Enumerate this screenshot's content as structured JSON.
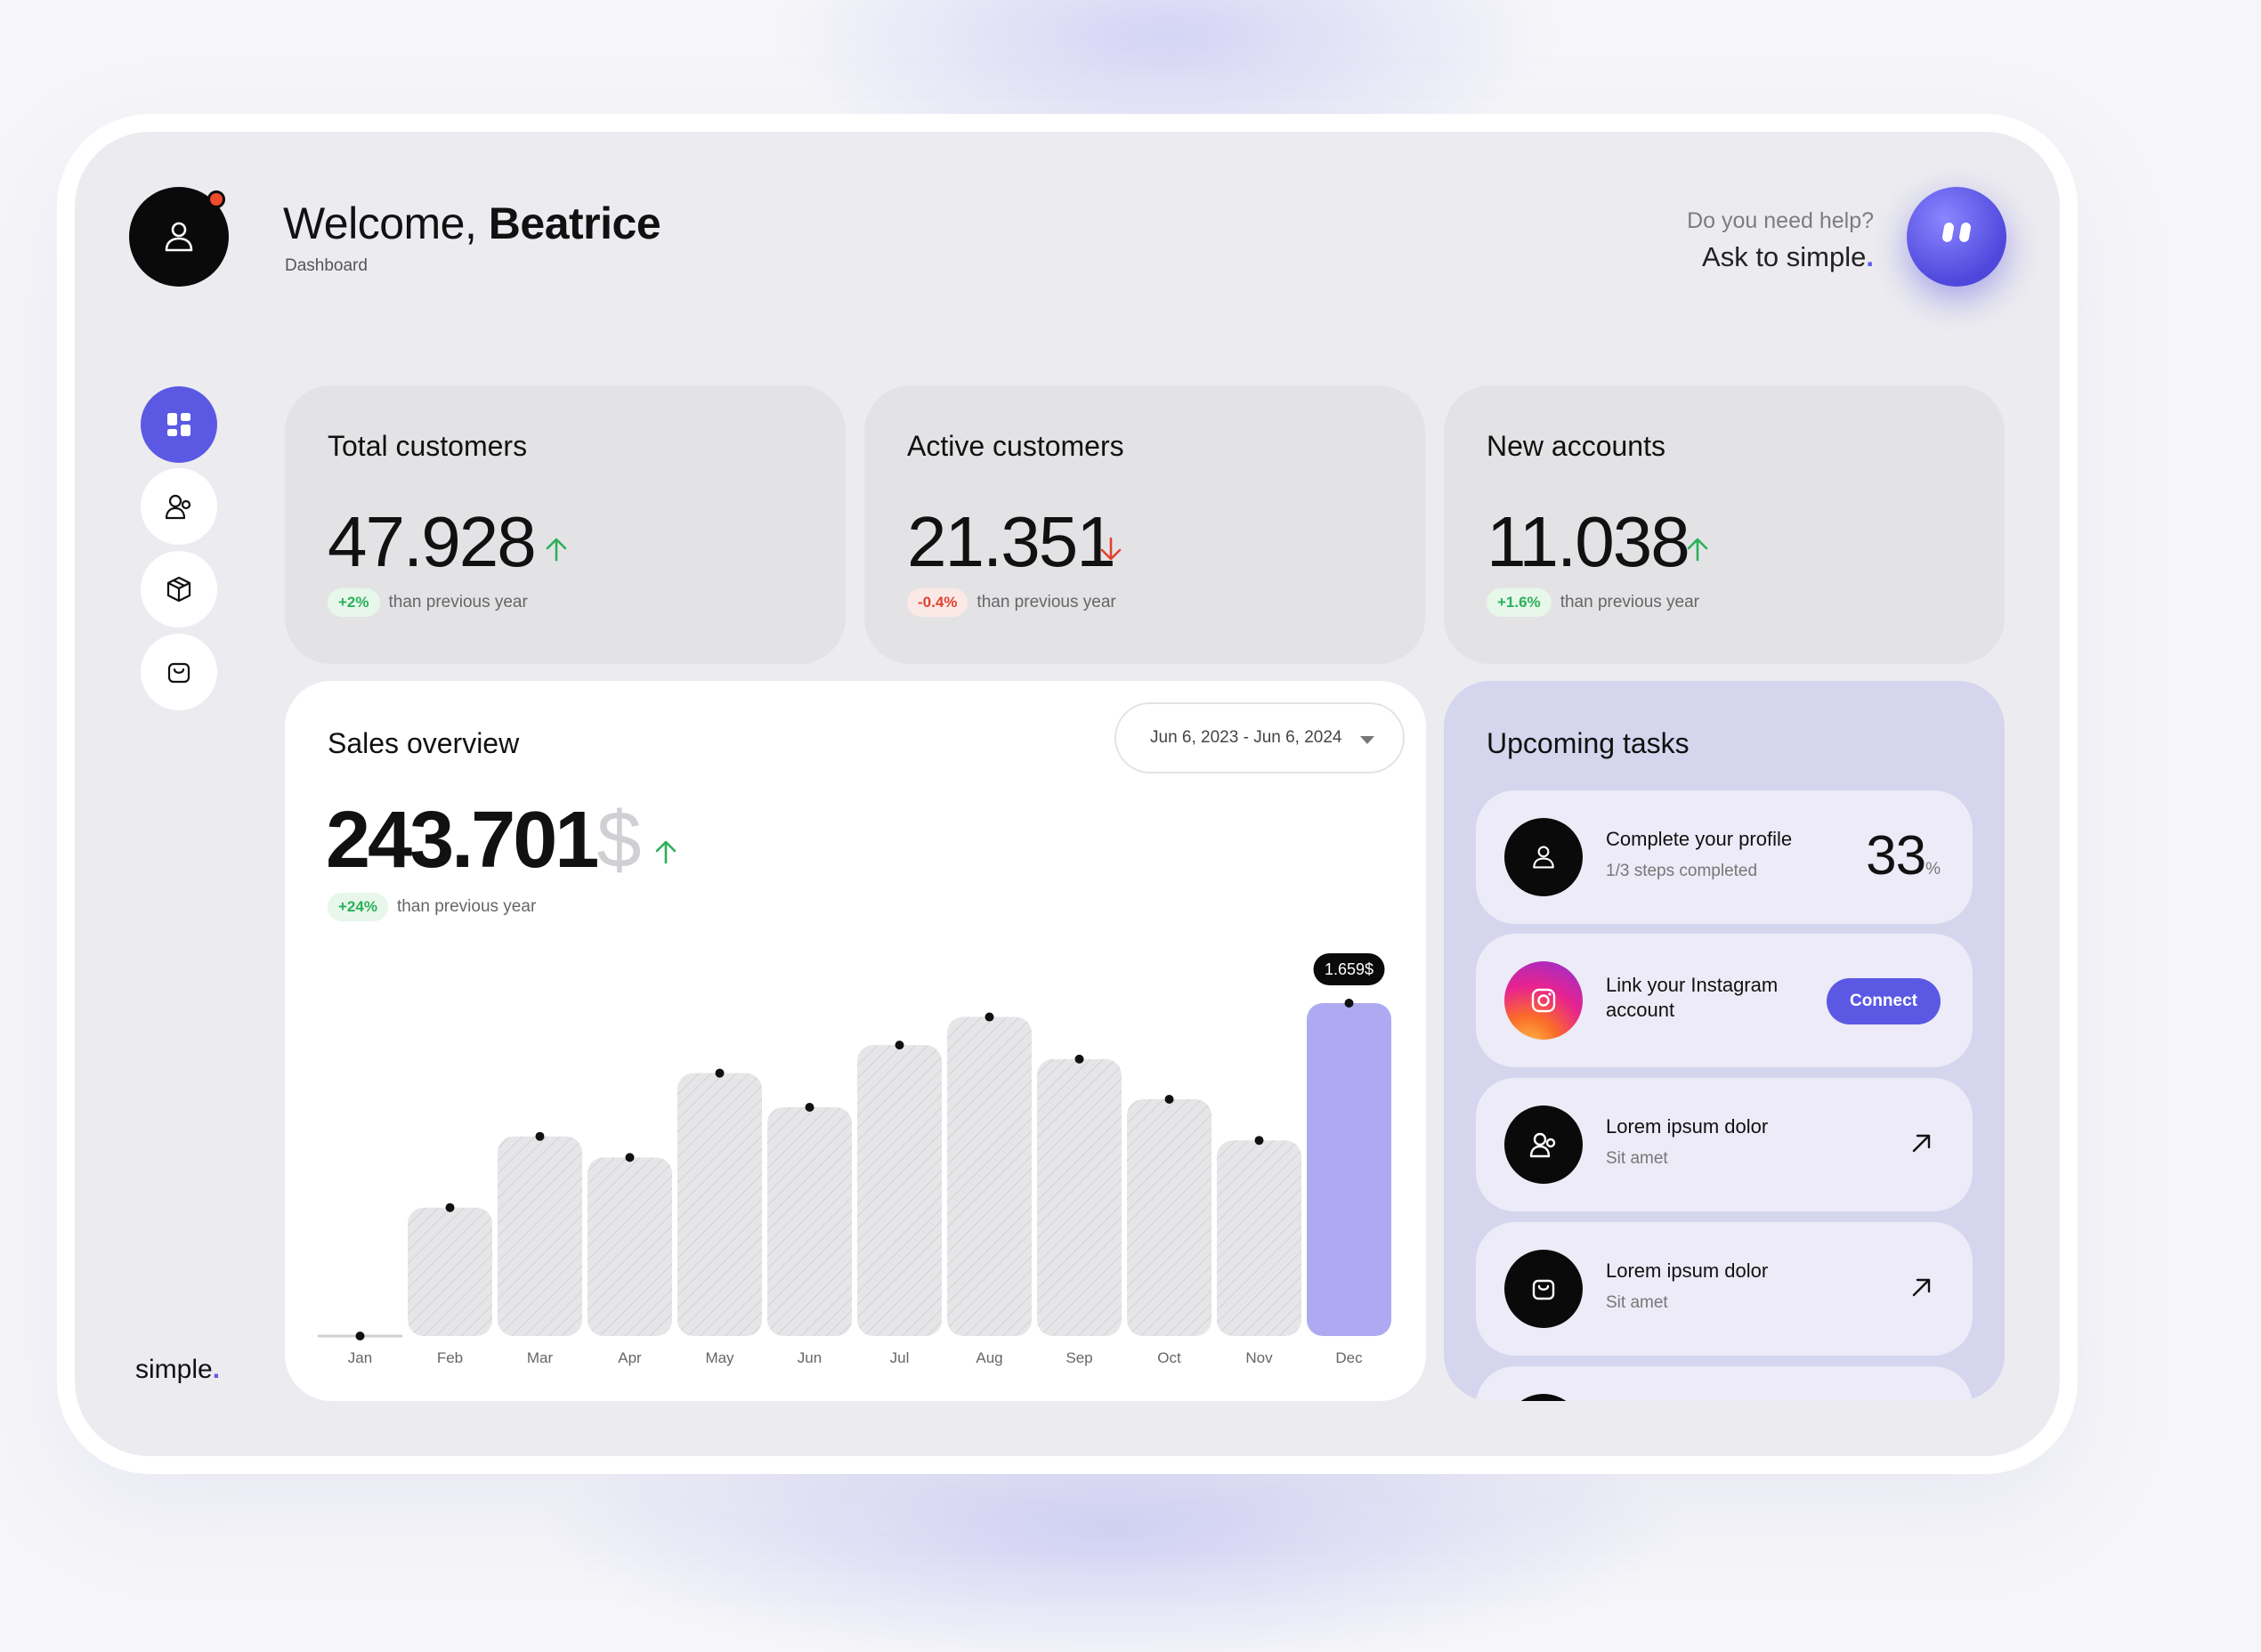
{
  "header": {
    "greeting": "Welcome,",
    "user_name": "Beatrice",
    "subtitle": "Dashboard",
    "help_question": "Do you need help?",
    "help_action": "Ask to simple",
    "help_dot": "."
  },
  "sidebar": {
    "items": [
      {
        "icon": "dashboard-icon",
        "active": true
      },
      {
        "icon": "users-icon",
        "active": false
      },
      {
        "icon": "box-icon",
        "active": false
      },
      {
        "icon": "bag-icon",
        "active": false
      }
    ],
    "brand": "simple",
    "brand_dot": "."
  },
  "stats": [
    {
      "title": "Total customers",
      "value": "47.928",
      "trend": "up",
      "change": "+2%",
      "compare": "than previous year"
    },
    {
      "title": "Active customers",
      "value": "21.351",
      "trend": "down",
      "change": "-0.4%",
      "compare": "than previous year"
    },
    {
      "title": "New accounts",
      "value": "11.038",
      "trend": "up",
      "change": "+1.6%",
      "compare": "than previous year"
    }
  ],
  "sales": {
    "title": "Sales overview",
    "date_range": "Jun 6, 2023 - Jun 6, 2024",
    "value": "243.701",
    "currency": "$",
    "change": "+24%",
    "compare": "than previous year",
    "tooltip": "1.659$"
  },
  "chart_data": {
    "type": "bar",
    "categories": [
      "Jan",
      "Feb",
      "Mar",
      "Apr",
      "May",
      "Jun",
      "Jul",
      "Aug",
      "Sep",
      "Oct",
      "Nov",
      "Dec"
    ],
    "values": [
      0,
      640,
      995,
      890,
      1310,
      1140,
      1450,
      1590,
      1380,
      1180,
      975,
      1659
    ],
    "highlight_index": 11,
    "ylim": [
      0,
      1659
    ],
    "colors": {
      "bar": "#e6e6e8",
      "hatch": "#d2d2d6",
      "highlight": "#aeaaf2",
      "point": "#111111"
    }
  },
  "tasks": {
    "title": "Upcoming tasks",
    "items": [
      {
        "icon": "user-icon",
        "title": "Complete your profile",
        "subtitle": "1/3 steps completed",
        "value": "33",
        "unit": "%"
      },
      {
        "icon": "instagram-icon",
        "title_line1": "Link your Instagram",
        "title_line2": "account",
        "action": "Connect"
      },
      {
        "icon": "users-icon",
        "title": "Lorem ipsum dolor",
        "subtitle": "Sit amet"
      },
      {
        "icon": "bag-icon",
        "title": "Lorem ipsum dolor",
        "subtitle": "Sit amet"
      }
    ]
  },
  "colors": {
    "accent": "#5b59e4",
    "up": "#2bb05a",
    "down": "#e0432f",
    "notification": "#ee4a2c"
  }
}
